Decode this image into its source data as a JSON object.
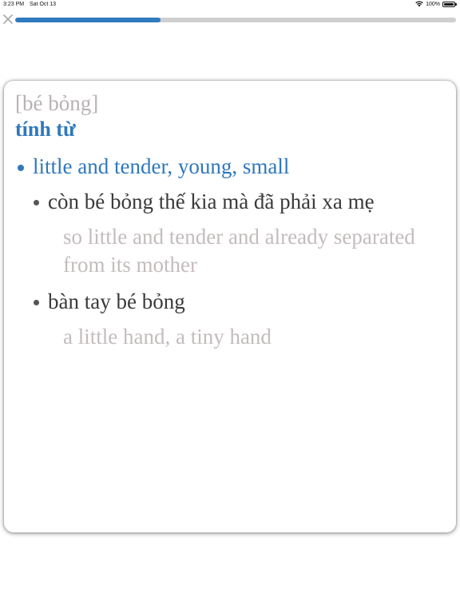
{
  "status_bar": {
    "time": "3:23 PM",
    "date": "Sat Oct 13",
    "battery_text": "100%",
    "icons": [
      "wifi-icon",
      "battery-icon"
    ]
  },
  "progress": {
    "fraction": 0.33,
    "fill_color": "#2f7bbf",
    "track_color": "#cfcfcf"
  },
  "close": {
    "icon": "close-icon"
  },
  "entry": {
    "pronunciation": "[bé bỏng]",
    "part_of_speech": "tính từ",
    "sense": "little and tender, young, small",
    "examples": [
      {
        "vi": "còn bé bỏng thế kia mà đã phải xa mẹ",
        "en": "so little and tender and already separated from its mother"
      },
      {
        "vi": "bàn tay bé bỏng",
        "en": "a little hand, a tiny hand"
      }
    ]
  },
  "colors": {
    "accent": "#2f78bd",
    "muted_text": "#c4bcbc",
    "body_text": "#3a3a3a"
  }
}
